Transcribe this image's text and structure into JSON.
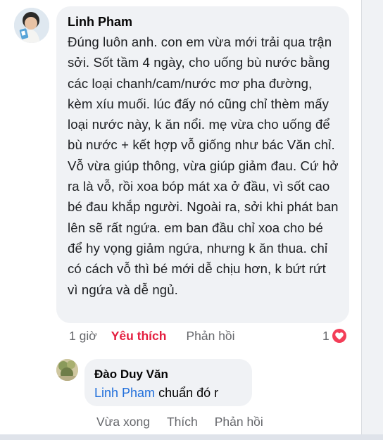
{
  "comment": {
    "author": "Linh Pham",
    "text": "Đúng luôn anh. con em vừa mới trải qua trận sởi. Sốt tầm 4 ngày, cho uống bù nước bằng các loại chanh/cam/nước mơ pha đường, kèm xíu muối. lúc đấy nó cũng chỉ thèm mấy loại nước này, k ăn nổi. mẹ vừa cho uống để bù nước + kết hợp vỗ giống như bác Văn chỉ. Vỗ vừa giúp thông, vừa giúp giảm đau. Cứ hở ra là vỗ, rồi xoa bóp mát xa ở đầu, vì sốt cao bé đau khắp người. Ngoài ra, sởi khi phát ban lên sẽ rất ngứa. em ban đầu chỉ xoa cho bé để hy vọng giảm ngứa, nhưng k ăn thua. chỉ có cách vỗ thì bé mới dễ chịu hơn, k bứt rứt vì ngứa và dễ ngủ.",
    "time": "1 giờ",
    "like_label": "Yêu thích",
    "reply_label": "Phản hồi",
    "reaction_count": "1",
    "reaction_icon": "heart-icon",
    "reaction_color": "#f33e58",
    "like_active_color": "#e41e3f"
  },
  "reply": {
    "author": "Đào Duy Văn",
    "mention": "Linh Pham",
    "text": " chuẩn đó r",
    "time": "Vừa xong",
    "like_label": "Thích",
    "reply_label": "Phản hồi",
    "mention_color": "#216fdb"
  }
}
